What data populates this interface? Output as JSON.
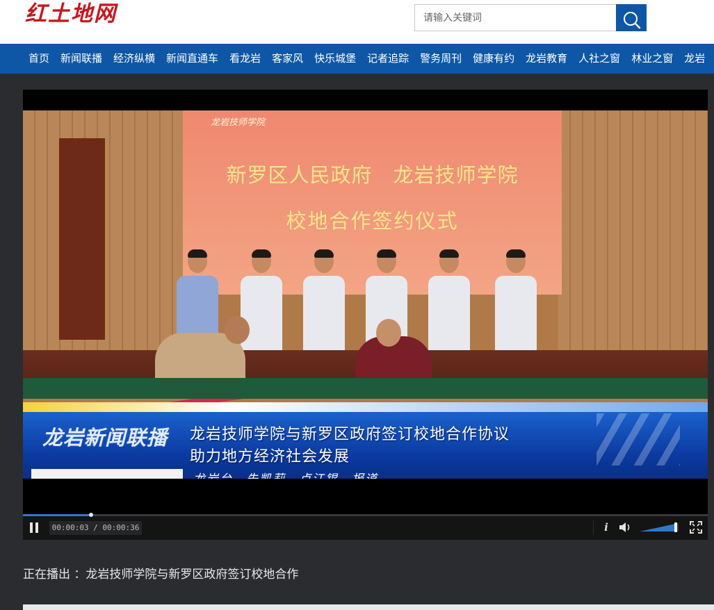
{
  "site": {
    "logo_text": "红土地网"
  },
  "search": {
    "placeholder": "请输入关键词"
  },
  "nav": {
    "items": [
      "首页",
      "新闻联播",
      "经济纵横",
      "新闻直通车",
      "看龙岩",
      "客家风",
      "快乐城堡",
      "记者追踪",
      "警务周刊",
      "健康有约",
      "龙岩教育",
      "人社之窗",
      "林业之窗",
      "龙岩"
    ]
  },
  "video": {
    "screen_logo": "龙岩技师学院",
    "screen_line1": "新罗区人民政府　龙岩技师学院",
    "screen_line2": "校地合作签约仪式",
    "ticker_brand": "龙岩新闻联播",
    "ticker_line1": "龙岩技师学院与新罗区政府签订校地合作协议",
    "ticker_line2": "助力地方经济社会发展",
    "ticker_credit": "龙岩台　朱凯莉　卢江锟　报道"
  },
  "player": {
    "current_time": "00:00:03",
    "duration": "00:00:36",
    "time_display": "00:00:03 / 00:00:36",
    "progress_fraction": 0.0999,
    "volume_fraction": 0.9,
    "info_label": "i"
  },
  "now_playing": {
    "text": "正在播出 ：龙岩技师学院与新罗区政府签订校地合作"
  },
  "colors": {
    "brand_red": "#c8161d",
    "nav_blue": "#0e56a6",
    "page_bg": "#2b2c30"
  }
}
